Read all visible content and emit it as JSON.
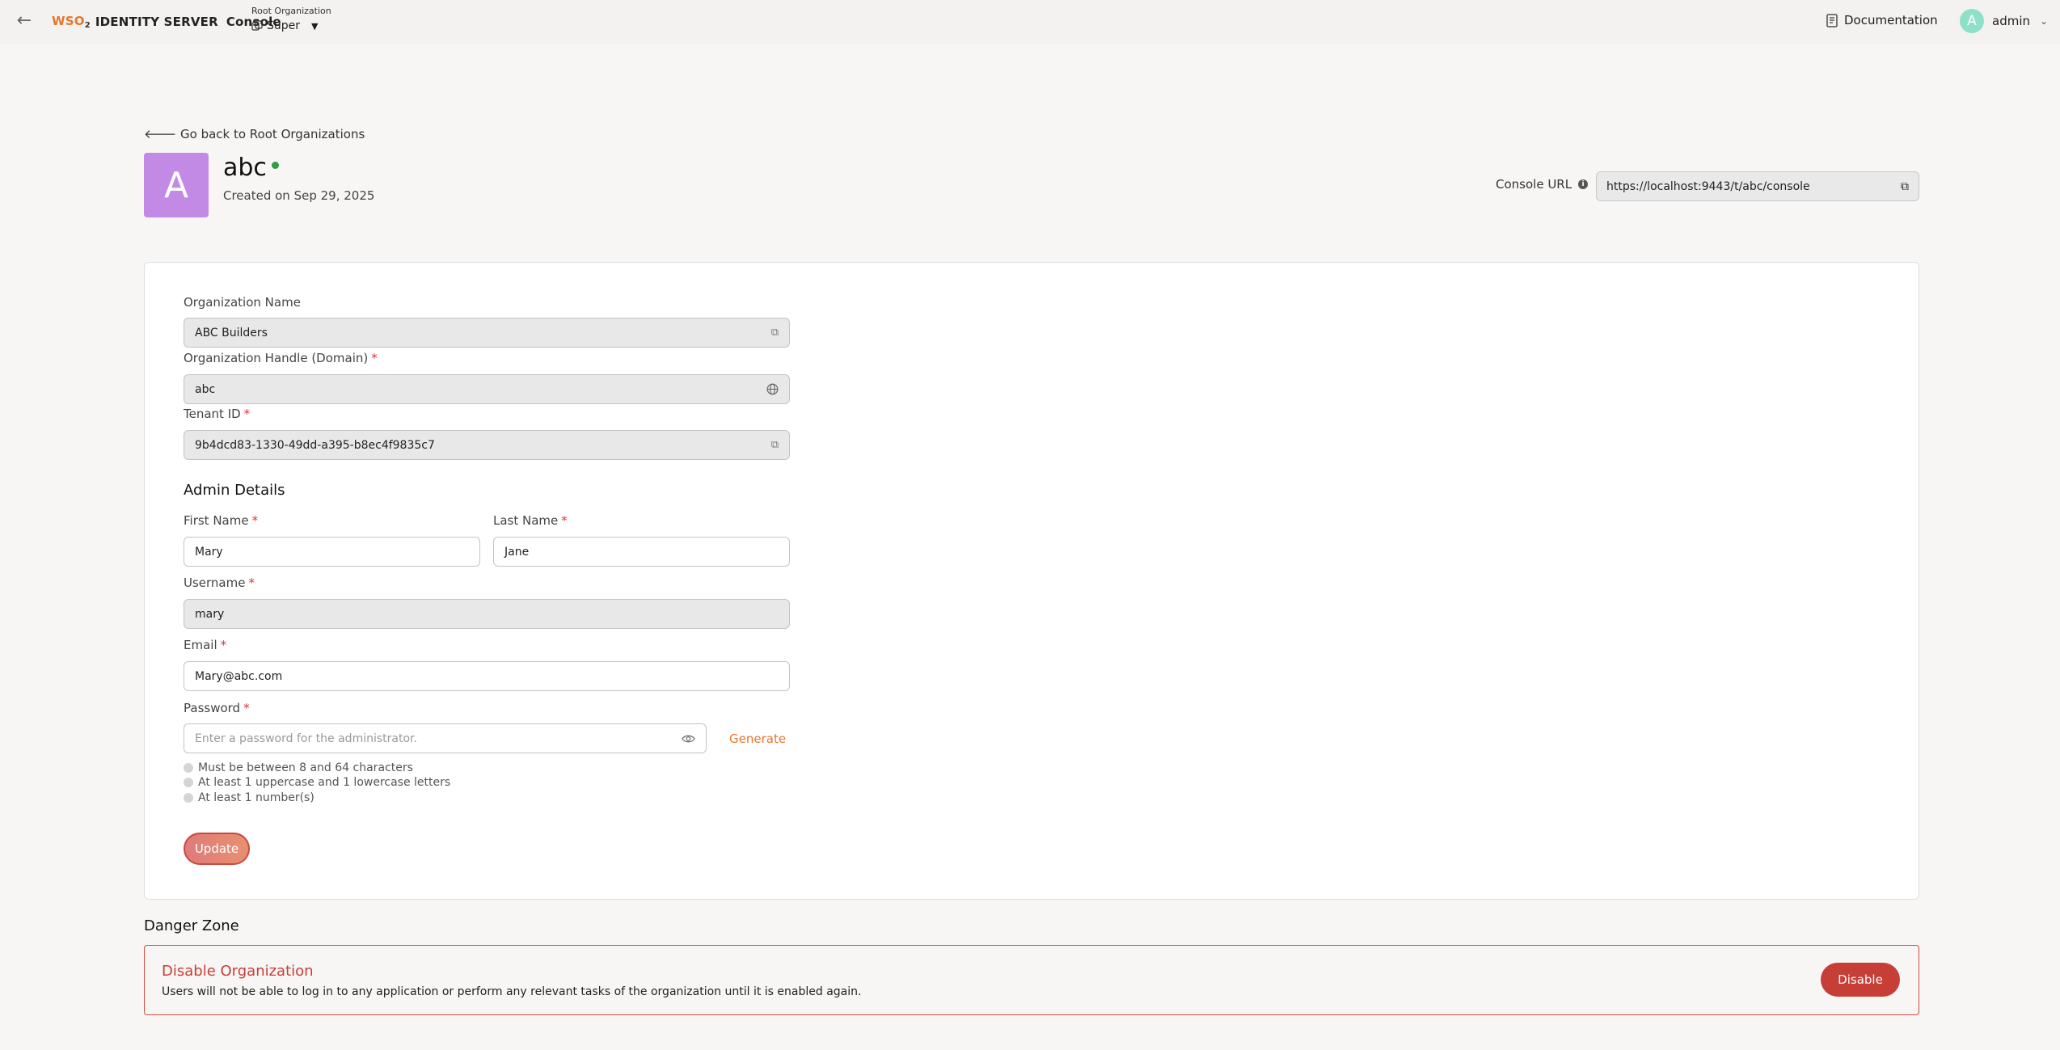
{
  "header": {
    "logo_wso": "WSO",
    "logo_sub": "2",
    "product": "IDENTITY SERVER",
    "console_label": "Console",
    "org_switch_label": "Root Organization",
    "org_switch_value": "Super",
    "documentation": "Documentation",
    "user_initial": "A",
    "user_name": "admin"
  },
  "page": {
    "go_back": "Go back to Root Organizations",
    "org_initial": "A",
    "org_name": "abc",
    "created": "Created on Sep 29, 2025",
    "console_url_label": "Console URL",
    "console_url": "https://localhost:9443/t/abc/console"
  },
  "form": {
    "org_name_label": "Organization Name",
    "org_name_value": "ABC Builders",
    "handle_label": "Organization Handle (Domain)",
    "handle_value": "abc",
    "tenant_label": "Tenant ID",
    "tenant_value": "9b4dcd83-1330-49dd-a395-b8ec4f9835c7",
    "admin_title": "Admin Details",
    "first_name_label": "First Name",
    "first_name_value": "Mary",
    "last_name_label": "Last Name",
    "last_name_value": "Jane",
    "username_label": "Username",
    "username_value": "mary",
    "email_label": "Email",
    "email_value": "Mary@abc.com",
    "password_label": "Password",
    "password_placeholder": "Enter a password for the administrator.",
    "generate": "Generate",
    "rules": [
      "Must be between 8 and 64 characters",
      "At least 1 uppercase and 1 lowercase letters",
      "At least 1 number(s)"
    ],
    "update": "Update",
    "required_mark": "*"
  },
  "danger": {
    "title": "Danger Zone",
    "heading": "Disable Organization",
    "description": "Users will not be able to log in to any application or perform any relevant tasks of the organization until it is enabled again.",
    "button": "Disable"
  },
  "colors": {
    "accent": "#e8762c",
    "danger": "#c63e36",
    "status_active": "#2e9d4a",
    "org_avatar": "#c289e5"
  }
}
